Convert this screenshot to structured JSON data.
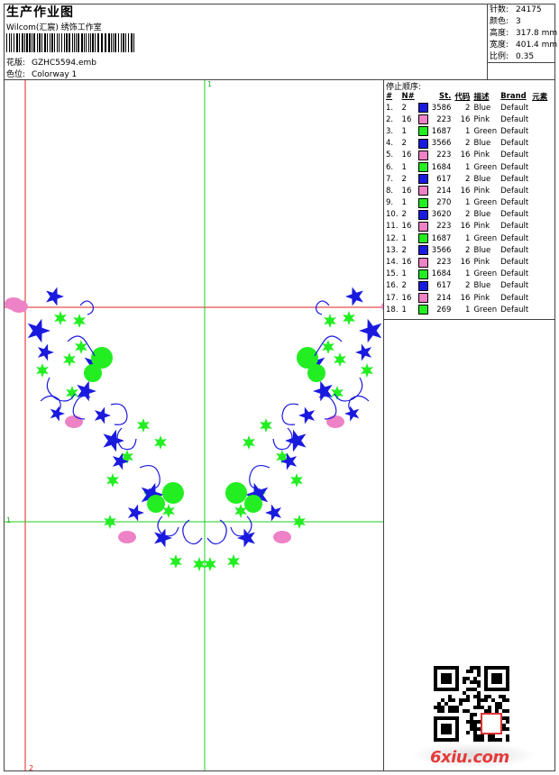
{
  "header": {
    "title": "生产作业图",
    "studio": "Wilcom(汇宸) 绣饰工作室",
    "pattern_label": "花版:",
    "pattern_value": "GZHC5594.emb",
    "colorway_label": "色位:",
    "colorway_value": "Colorway 1"
  },
  "stats": [
    {
      "label": "针数:",
      "value": "24175"
    },
    {
      "label": "颜色:",
      "value": "3"
    },
    {
      "label": "高度:",
      "value": "317.8 mm"
    },
    {
      "label": "宽度:",
      "value": "401.4 mm"
    },
    {
      "label": "比例:",
      "value": "0.35"
    }
  ],
  "stop_sequence": {
    "title": "停止顺序:",
    "headers": [
      "#",
      "N#",
      "St.",
      "代码",
      "描述",
      "Brand",
      "元素"
    ],
    "rows": [
      {
        "idx": "1.",
        "n": "2",
        "color": "#1a1adf",
        "st": "3586",
        "code": "2",
        "desc": "Blue",
        "brand": "Default"
      },
      {
        "idx": "2.",
        "n": "16",
        "color": "#ee82c6",
        "st": "223",
        "code": "16",
        "desc": "Pink",
        "brand": "Default"
      },
      {
        "idx": "3.",
        "n": "1",
        "color": "#22ee22",
        "st": "1687",
        "code": "1",
        "desc": "Green",
        "brand": "Default"
      },
      {
        "idx": "4.",
        "n": "2",
        "color": "#1a1adf",
        "st": "3566",
        "code": "2",
        "desc": "Blue",
        "brand": "Default"
      },
      {
        "idx": "5.",
        "n": "16",
        "color": "#ee82c6",
        "st": "223",
        "code": "16",
        "desc": "Pink",
        "brand": "Default"
      },
      {
        "idx": "6.",
        "n": "1",
        "color": "#22ee22",
        "st": "1684",
        "code": "1",
        "desc": "Green",
        "brand": "Default"
      },
      {
        "idx": "7.",
        "n": "2",
        "color": "#1a1adf",
        "st": "617",
        "code": "2",
        "desc": "Blue",
        "brand": "Default"
      },
      {
        "idx": "8.",
        "n": "16",
        "color": "#ee82c6",
        "st": "214",
        "code": "16",
        "desc": "Pink",
        "brand": "Default"
      },
      {
        "idx": "9.",
        "n": "1",
        "color": "#22ee22",
        "st": "270",
        "code": "1",
        "desc": "Green",
        "brand": "Default"
      },
      {
        "idx": "10.",
        "n": "2",
        "color": "#1a1adf",
        "st": "3620",
        "code": "2",
        "desc": "Blue",
        "brand": "Default"
      },
      {
        "idx": "11.",
        "n": "16",
        "color": "#ee82c6",
        "st": "223",
        "code": "16",
        "desc": "Pink",
        "brand": "Default"
      },
      {
        "idx": "12.",
        "n": "1",
        "color": "#22ee22",
        "st": "1687",
        "code": "1",
        "desc": "Green",
        "brand": "Default"
      },
      {
        "idx": "13.",
        "n": "2",
        "color": "#1a1adf",
        "st": "3566",
        "code": "2",
        "desc": "Blue",
        "brand": "Default"
      },
      {
        "idx": "14.",
        "n": "16",
        "color": "#ee82c6",
        "st": "223",
        "code": "16",
        "desc": "Pink",
        "brand": "Default"
      },
      {
        "idx": "15.",
        "n": "1",
        "color": "#22ee22",
        "st": "1684",
        "code": "1",
        "desc": "Green",
        "brand": "Default"
      },
      {
        "idx": "16.",
        "n": "2",
        "color": "#1a1adf",
        "st": "617",
        "code": "2",
        "desc": "Blue",
        "brand": "Default"
      },
      {
        "idx": "17.",
        "n": "16",
        "color": "#ee82c6",
        "st": "214",
        "code": "16",
        "desc": "Pink",
        "brand": "Default"
      },
      {
        "idx": "18.",
        "n": "1",
        "color": "#22ee22",
        "st": "269",
        "code": "1",
        "desc": "Green",
        "brand": "Default"
      }
    ]
  },
  "guides": {
    "top_marker": "1",
    "left_marker": "1",
    "bottom_marker": "2"
  },
  "thread_colors": {
    "blue": "#1a1adf",
    "pink": "#ee82c6",
    "green": "#22ee22",
    "guide_red": "#e02020",
    "guide_green": "#22cc22"
  },
  "watermark": "6xiu.com"
}
